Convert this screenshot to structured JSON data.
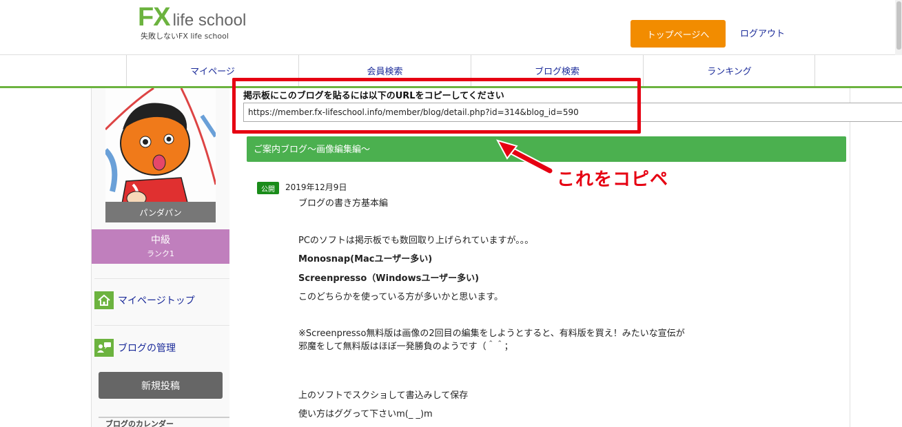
{
  "header": {
    "logo_fx": "FX",
    "logo_text": "life school",
    "tagline": "失敗しないFX life school",
    "top_button": "トップページへ",
    "logout": "ログアウト"
  },
  "nav": [
    "マイページ",
    "会員検索",
    "ブログ検索",
    "ランキング"
  ],
  "sidebar": {
    "user_name": "パンダパン",
    "rank_level": "中級",
    "rank_num": "ランク1",
    "link_mypage": "マイページトップ",
    "link_blog_manage": "ブログの管理",
    "new_post": "新規投稿",
    "calendar_title": "ブログのカレンダー"
  },
  "share": {
    "label": "掲示板にこのブログを貼るには以下のURLをコピーしてください",
    "url": "https://member.fx-lifeschool.info/member/blog/detail.php?id=314&blog_id=590"
  },
  "annotation": "これをコピペ",
  "colors": {
    "annotation_red": "#e60012",
    "brand_green": "#6cb33f",
    "button_orange": "#f28c00",
    "title_bar_green": "#4bb04f",
    "rank_purple": "#c07fbd"
  },
  "post": {
    "title": "ご案内ブログ〜画像編集編〜",
    "badge": "公開",
    "date": "2019年12月9日",
    "lines": [
      "ブログの書き方基本編",
      "PCのソフトは掲示板でも数回取り上げられていますが。。。",
      "Monosnap(Macユーザー多い)",
      "Screenpresso（Windowsユーザー多い)",
      "このどちらかを使っている方が多いかと思います。",
      "※Screenpresso無料版は画像の2回目の編集をしようとすると、有料版を買え！みたいな宣伝が",
      "邪魔をして無料版はほぼ一発勝負のようです（＾＾；",
      "上のソフトでスクショして書込みして保存",
      "使い方はググって下さいm(_ _)m"
    ]
  }
}
